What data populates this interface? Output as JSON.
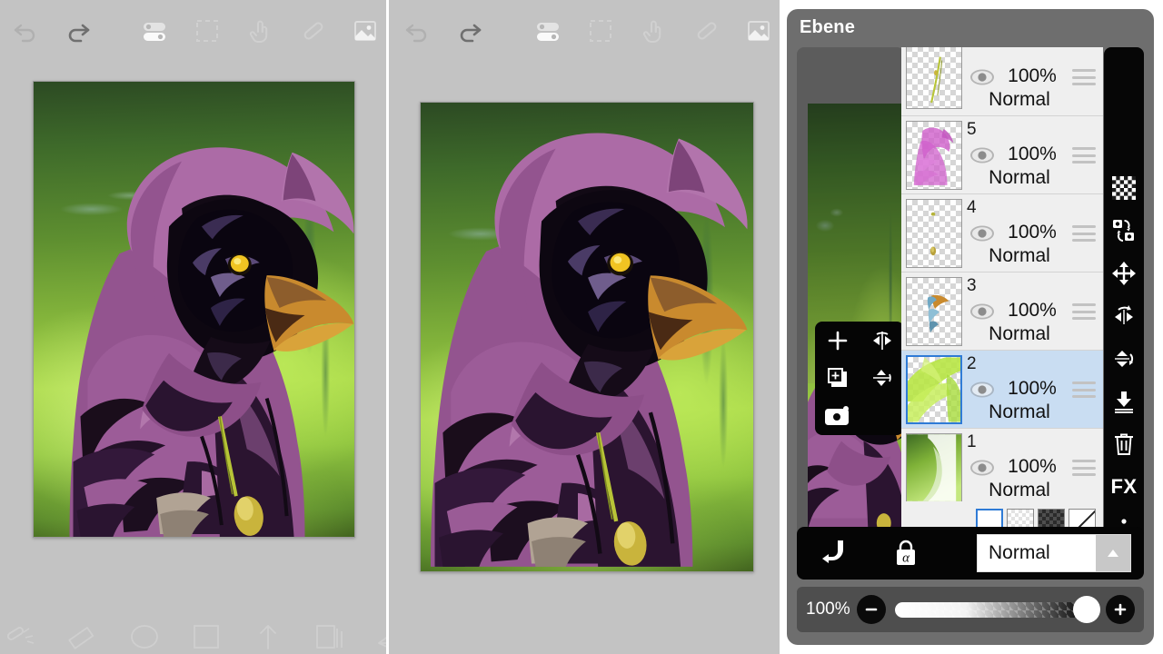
{
  "app": {
    "layer_panel_title": "Ebene"
  },
  "toolbar": {
    "icons": [
      {
        "name": "undo-icon",
        "label": "Undo"
      },
      {
        "name": "redo-icon",
        "label": "Redo"
      },
      {
        "name": "toggles-icon",
        "label": "Settings"
      },
      {
        "name": "selection-icon",
        "label": "Selection"
      },
      {
        "name": "finger-icon",
        "label": "Finger"
      },
      {
        "name": "pencil-icon",
        "label": "Pencil"
      },
      {
        "name": "image-icon",
        "label": "Image"
      }
    ]
  },
  "bottombar": {
    "icons": [
      {
        "name": "brush-icon",
        "label": "Brush"
      },
      {
        "name": "eraser-icon",
        "label": "Eraser"
      },
      {
        "name": "blur-icon",
        "label": "Blur"
      },
      {
        "name": "fill-icon",
        "label": "Fill"
      },
      {
        "name": "transform-icon",
        "label": "Transform"
      },
      {
        "name": "layers-icon",
        "label": "Layers"
      },
      {
        "name": "back-icon",
        "label": "Back"
      }
    ]
  },
  "layer_panel": {
    "title": "Ebene",
    "preview_tools": [
      {
        "name": "add-layer-icon",
        "label": "Add layer"
      },
      {
        "name": "flip-horizontal-icon",
        "label": "Flip horizontal"
      },
      {
        "name": "duplicate-layer-icon",
        "label": "Duplicate layer"
      },
      {
        "name": "flip-vertical-icon",
        "label": "Flip vertical"
      },
      {
        "name": "camera-icon",
        "label": "Camera"
      }
    ],
    "layers": [
      {
        "number": "",
        "opacity": "100%",
        "blend": "Normal",
        "selected": false,
        "thumb": "stem"
      },
      {
        "number": "5",
        "opacity": "100%",
        "blend": "Normal",
        "selected": false,
        "thumb": "magenta-figure"
      },
      {
        "number": "4",
        "opacity": "100%",
        "blend": "Normal",
        "selected": false,
        "thumb": "specks"
      },
      {
        "number": "3",
        "opacity": "100%",
        "blend": "Normal",
        "selected": false,
        "thumb": "beak"
      },
      {
        "number": "2",
        "opacity": "100%",
        "blend": "Normal",
        "selected": true,
        "thumb": "green-strokes"
      },
      {
        "number": "1",
        "opacity": "100%",
        "blend": "Normal",
        "selected": false,
        "thumb": "green-bg"
      }
    ],
    "background_options": [
      {
        "name": "bg-white",
        "style": "white",
        "selected": true
      },
      {
        "name": "bg-light-checker",
        "style": "light",
        "selected": false
      },
      {
        "name": "bg-dark-checker",
        "style": "dark",
        "selected": false
      },
      {
        "name": "bg-none",
        "style": "none",
        "selected": false
      }
    ],
    "rail_icons": [
      {
        "name": "checkerboard-icon",
        "label": "Transparency"
      },
      {
        "name": "rotate-swap-icon",
        "label": "Rotate"
      },
      {
        "name": "move-icon",
        "label": "Move"
      },
      {
        "name": "flip-horizontal-icon",
        "label": "Flip horizontal"
      },
      {
        "name": "flip-vertical-icon",
        "label": "Flip vertical"
      },
      {
        "name": "merge-down-icon",
        "label": "Merge down"
      },
      {
        "name": "trash-icon",
        "label": "Delete"
      },
      {
        "name": "fx-icon",
        "label": "FX"
      },
      {
        "name": "more-options-icon",
        "label": "More"
      }
    ],
    "fx_label": "FX",
    "mode_bar": {
      "clipping_icon": "clipping-mask-icon",
      "alpha_lock_icon": "alpha-lock-icon",
      "blend_mode": "Normal"
    },
    "opacity": {
      "value": "100%",
      "minus_label": "−",
      "plus_label": "+"
    }
  },
  "colors": {
    "panel_bg": "#c3c3c3",
    "layer_window_bg": "#6e6e6e",
    "layer_row_bg": "#efefef",
    "layer_row_selected": "#c9ddf2",
    "accent_blue": "#2f7bd6",
    "rail_black": "#060606",
    "slider_bg": "#4e4e4e"
  }
}
